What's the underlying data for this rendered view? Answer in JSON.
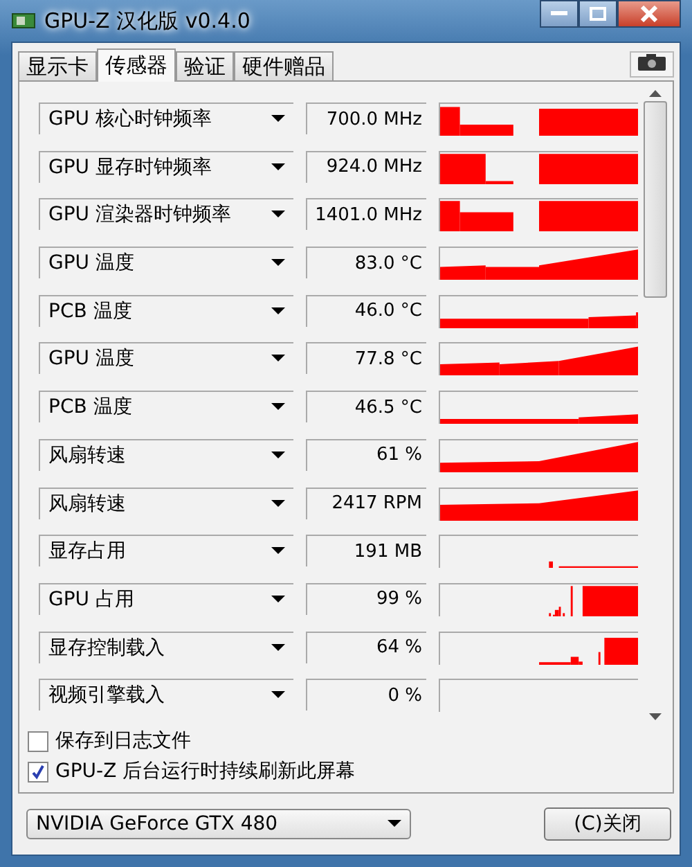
{
  "window": {
    "title": "GPU-Z 汉化版 v0.4.0"
  },
  "tabs": [
    {
      "label": "显示卡",
      "selected": false
    },
    {
      "label": "传感器",
      "selected": true
    },
    {
      "label": "验证",
      "selected": false
    },
    {
      "label": "硬件赠品",
      "selected": false
    }
  ],
  "sensors": [
    {
      "label": "GPU 核心时钟频率",
      "value": "700.0 MHz"
    },
    {
      "label": "GPU 显存时钟频率",
      "value": "924.0 MHz"
    },
    {
      "label": "GPU 渲染器时钟频率",
      "value": "1401.0 MHz"
    },
    {
      "label": "GPU 温度",
      "value": "83.0 °C"
    },
    {
      "label": "PCB 温度",
      "value": "46.0 °C"
    },
    {
      "label": "GPU 温度",
      "value": "77.8 °C"
    },
    {
      "label": "PCB 温度",
      "value": "46.5 °C"
    },
    {
      "label": "风扇转速",
      "value": "61 %"
    },
    {
      "label": "风扇转速",
      "value": "2417 RPM"
    },
    {
      "label": "显存占用",
      "value": "191 MB"
    },
    {
      "label": "GPU 占用",
      "value": "99 %"
    },
    {
      "label": "显存控制载入",
      "value": "64 %"
    },
    {
      "label": "视频引擎载入",
      "value": "0 %"
    }
  ],
  "options": [
    {
      "label": "保存到日志文件",
      "checked": false
    },
    {
      "label": "GPU-Z 后台运行时持续刷新此屏幕",
      "checked": true
    }
  ],
  "device": {
    "value": "NVIDIA GeForce GTX 480"
  },
  "close_button": {
    "label": "(C)关闭"
  }
}
